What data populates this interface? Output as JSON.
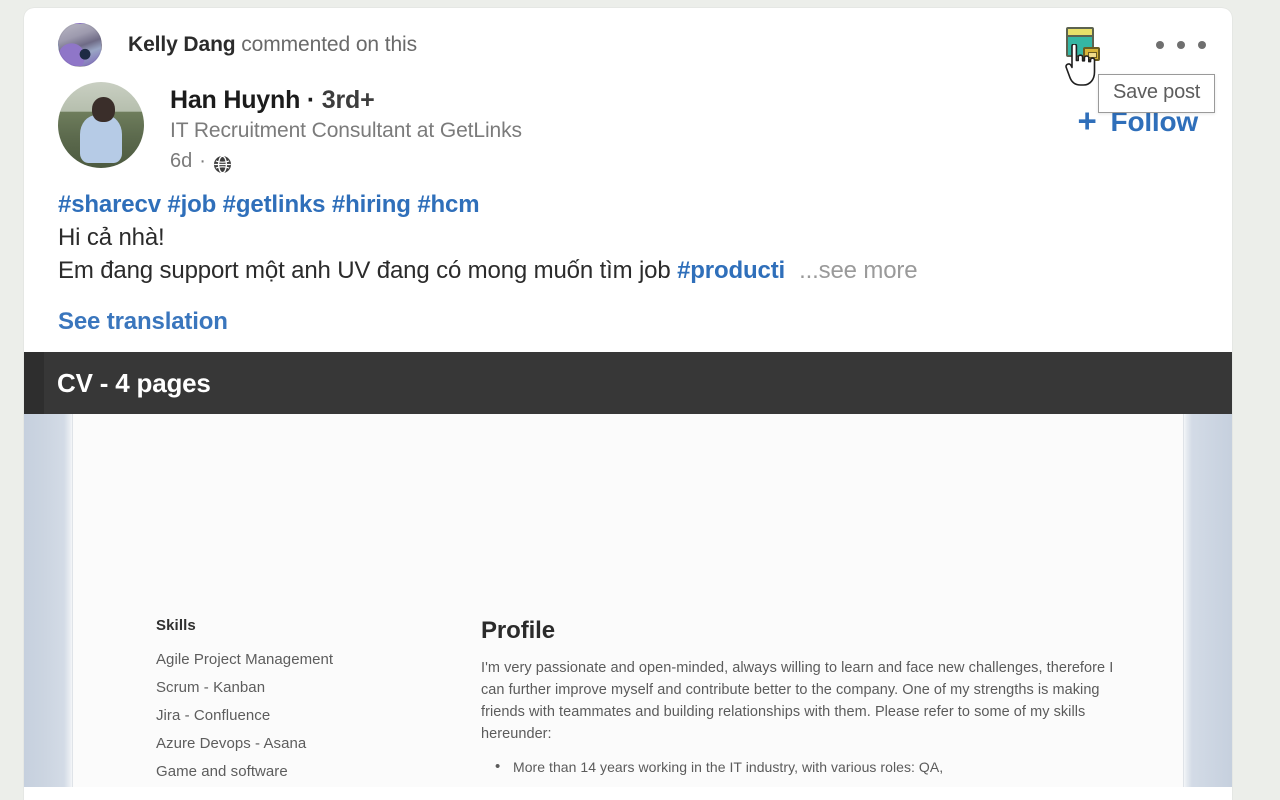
{
  "theme": {
    "page_background": "#eceeea",
    "card_background": "#ffffff",
    "link_blue": "#2f6fba",
    "muted_gray": "#7b7b7b",
    "doc_titlebar": "#373737",
    "save_icon_teal": "#35b6a4",
    "save_icon_gold": "#d8b63a"
  },
  "context": {
    "actor_name": "Kelly Dang",
    "action_text": " commented on this",
    "avatar_icon": "kelly-dang-avatar",
    "save_icon": "save-post-bookmark-icon",
    "menu_icon": "more-options-kebab-icon",
    "cursor_icon": "hand-pointer-cursor"
  },
  "tooltip": {
    "label": "Save post"
  },
  "author": {
    "avatar_icon": "han-huynh-avatar",
    "name": "Han Huynh",
    "separator": " · ",
    "degree": "3rd+",
    "headline": "IT Recruitment Consultant at GetLinks",
    "time_ago": "6d",
    "time_separator": " · ",
    "visibility_icon": "globe-public-icon",
    "follow_plus": "+",
    "follow_label": "Follow"
  },
  "post": {
    "hashtag_line": "#sharecv #job #getlinks #hiring #hcm",
    "line_2": "Hi cả nhà!",
    "line_3_prefix": "Em đang support một anh UV đang có mong muốn tìm job ",
    "line_3_hashtag": "#producti",
    "see_more": "...see more",
    "see_translation": "See translation"
  },
  "document": {
    "title": "CV - 4 pages",
    "skills_heading": "Skills",
    "skills": [
      "Agile Project Management",
      "Scrum - Kanban",
      "Jira - Confluence",
      "Azure Devops - Asana",
      "Game and software"
    ],
    "profile_heading": "Profile",
    "profile_paragraph": "I'm very passionate and open-minded, always willing to learn and face new challenges, therefore I can further improve myself and contribute better to the company. One of my strengths is making friends with teammates and building relationships with them. Please refer to some of my skills hereunder:",
    "profile_bullets": [
      "More than 14 years working in the IT industry, with various roles: QA,"
    ]
  }
}
